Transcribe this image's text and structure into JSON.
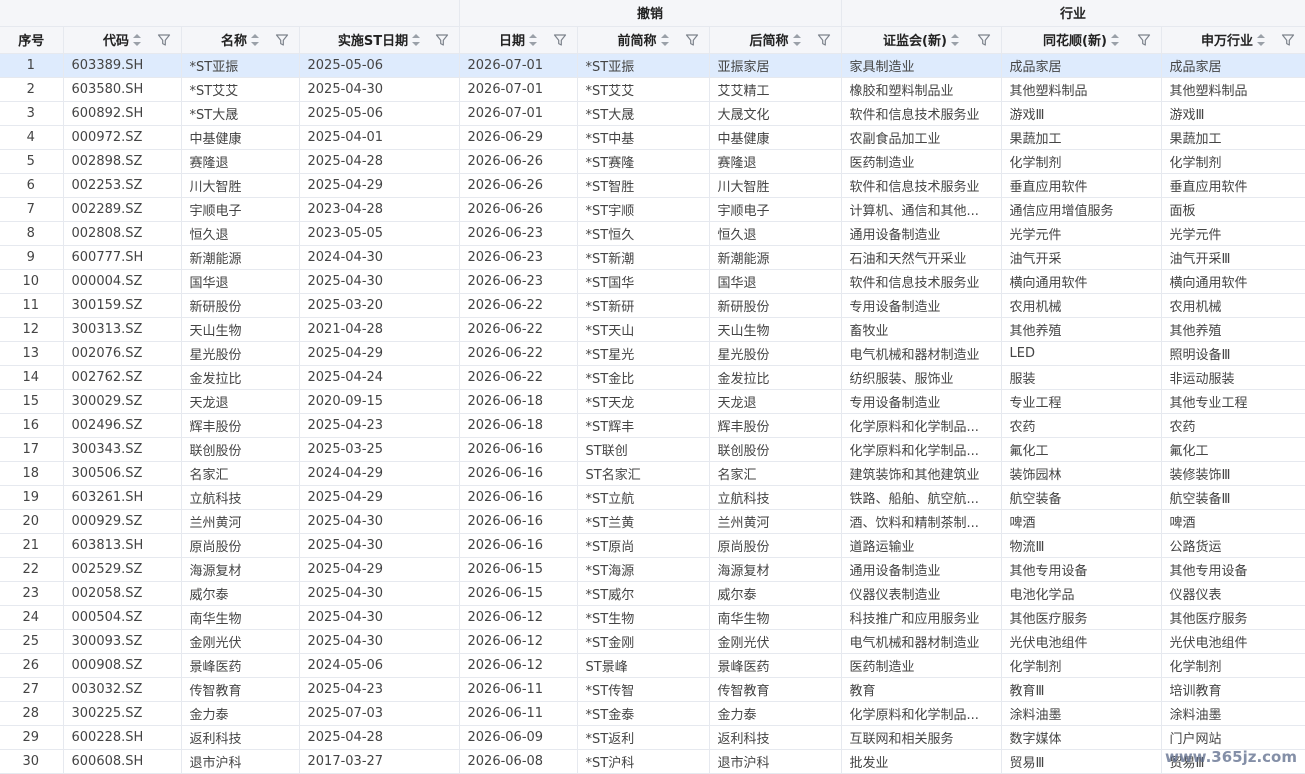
{
  "header": {
    "groups": {
      "revoke": "撤销",
      "industry": "行业"
    },
    "columns": [
      "序号",
      "代码",
      "名称",
      "实施ST日期",
      "日期",
      "前简称",
      "后简称",
      "证监会(新)",
      "同花顺(新)",
      "申万行业"
    ]
  },
  "rows": [
    [
      "1",
      "603389.SH",
      "*ST亚振",
      "2025-05-06",
      "2026-07-01",
      "*ST亚振",
      "亚振家居",
      "家具制造业",
      "成品家居",
      "成品家居"
    ],
    [
      "2",
      "603580.SH",
      "*ST艾艾",
      "2025-04-30",
      "2026-07-01",
      "*ST艾艾",
      "艾艾精工",
      "橡胶和塑料制品业",
      "其他塑料制品",
      "其他塑料制品"
    ],
    [
      "3",
      "600892.SH",
      "*ST大晟",
      "2025-05-06",
      "2026-07-01",
      "*ST大晟",
      "大晟文化",
      "软件和信息技术服务业",
      "游戏Ⅲ",
      "游戏Ⅲ"
    ],
    [
      "4",
      "000972.SZ",
      "中基健康",
      "2025-04-01",
      "2026-06-29",
      "*ST中基",
      "中基健康",
      "农副食品加工业",
      "果蔬加工",
      "果蔬加工"
    ],
    [
      "5",
      "002898.SZ",
      "赛隆退",
      "2025-04-28",
      "2026-06-26",
      "*ST赛隆",
      "赛隆退",
      "医药制造业",
      "化学制剂",
      "化学制剂"
    ],
    [
      "6",
      "002253.SZ",
      "川大智胜",
      "2025-04-29",
      "2026-06-26",
      "*ST智胜",
      "川大智胜",
      "软件和信息技术服务业",
      "垂直应用软件",
      "垂直应用软件"
    ],
    [
      "7",
      "002289.SZ",
      "宇顺电子",
      "2023-04-28",
      "2026-06-26",
      "*ST宇顺",
      "宇顺电子",
      "计算机、通信和其他...",
      "通信应用增值服务",
      "面板"
    ],
    [
      "8",
      "002808.SZ",
      "恒久退",
      "2023-05-05",
      "2026-06-23",
      "*ST恒久",
      "恒久退",
      "通用设备制造业",
      "光学元件",
      "光学元件"
    ],
    [
      "9",
      "600777.SH",
      "新潮能源",
      "2024-04-30",
      "2026-06-23",
      "*ST新潮",
      "新潮能源",
      "石油和天然气开采业",
      "油气开采",
      "油气开采Ⅲ"
    ],
    [
      "10",
      "000004.SZ",
      "国华退",
      "2025-04-30",
      "2026-06-23",
      "*ST国华",
      "国华退",
      "软件和信息技术服务业",
      "横向通用软件",
      "横向通用软件"
    ],
    [
      "11",
      "300159.SZ",
      "新研股份",
      "2025-03-20",
      "2026-06-22",
      "*ST新研",
      "新研股份",
      "专用设备制造业",
      "农用机械",
      "农用机械"
    ],
    [
      "12",
      "300313.SZ",
      "天山生物",
      "2021-04-28",
      "2026-06-22",
      "*ST天山",
      "天山生物",
      "畜牧业",
      "其他养殖",
      "其他养殖"
    ],
    [
      "13",
      "002076.SZ",
      "星光股份",
      "2025-04-29",
      "2026-06-22",
      "*ST星光",
      "星光股份",
      "电气机械和器材制造业",
      "LED",
      "照明设备Ⅲ"
    ],
    [
      "14",
      "002762.SZ",
      "金发拉比",
      "2025-04-24",
      "2026-06-22",
      "*ST金比",
      "金发拉比",
      "纺织服装、服饰业",
      "服装",
      "非运动服装"
    ],
    [
      "15",
      "300029.SZ",
      "天龙退",
      "2020-09-15",
      "2026-06-18",
      "*ST天龙",
      "天龙退",
      "专用设备制造业",
      "专业工程",
      "其他专业工程"
    ],
    [
      "16",
      "002496.SZ",
      "辉丰股份",
      "2025-04-23",
      "2026-06-18",
      "*ST辉丰",
      "辉丰股份",
      "化学原料和化学制品...",
      "农药",
      "农药"
    ],
    [
      "17",
      "300343.SZ",
      "联创股份",
      "2025-03-25",
      "2026-06-16",
      "ST联创",
      "联创股份",
      "化学原料和化学制品...",
      "氟化工",
      "氟化工"
    ],
    [
      "18",
      "300506.SZ",
      "名家汇",
      "2024-04-29",
      "2026-06-16",
      "ST名家汇",
      "名家汇",
      "建筑装饰和其他建筑业",
      "装饰园林",
      "装修装饰Ⅲ"
    ],
    [
      "19",
      "603261.SH",
      "立航科技",
      "2025-04-29",
      "2026-06-16",
      "*ST立航",
      "立航科技",
      "铁路、船舶、航空航...",
      "航空装备",
      "航空装备Ⅲ"
    ],
    [
      "20",
      "000929.SZ",
      "兰州黄河",
      "2025-04-30",
      "2026-06-16",
      "*ST兰黄",
      "兰州黄河",
      "酒、饮料和精制茶制...",
      "啤酒",
      "啤酒"
    ],
    [
      "21",
      "603813.SH",
      "原尚股份",
      "2025-04-30",
      "2026-06-16",
      "*ST原尚",
      "原尚股份",
      "道路运输业",
      "物流Ⅲ",
      "公路货运"
    ],
    [
      "22",
      "002529.SZ",
      "海源复材",
      "2025-04-29",
      "2026-06-15",
      "*ST海源",
      "海源复材",
      "通用设备制造业",
      "其他专用设备",
      "其他专用设备"
    ],
    [
      "23",
      "002058.SZ",
      "威尔泰",
      "2025-04-30",
      "2026-06-15",
      "*ST威尔",
      "威尔泰",
      "仪器仪表制造业",
      "电池化学品",
      "仪器仪表"
    ],
    [
      "24",
      "000504.SZ",
      "南华生物",
      "2025-04-30",
      "2026-06-12",
      "*ST生物",
      "南华生物",
      "科技推广和应用服务业",
      "其他医疗服务",
      "其他医疗服务"
    ],
    [
      "25",
      "300093.SZ",
      "金刚光伏",
      "2025-04-30",
      "2026-06-12",
      "*ST金刚",
      "金刚光伏",
      "电气机械和器材制造业",
      "光伏电池组件",
      "光伏电池组件"
    ],
    [
      "26",
      "000908.SZ",
      "景峰医药",
      "2024-05-06",
      "2026-06-12",
      "ST景峰",
      "景峰医药",
      "医药制造业",
      "化学制剂",
      "化学制剂"
    ],
    [
      "27",
      "003032.SZ",
      "传智教育",
      "2025-04-23",
      "2026-06-11",
      "*ST传智",
      "传智教育",
      "教育",
      "教育Ⅲ",
      "培训教育"
    ],
    [
      "28",
      "300225.SZ",
      "金力泰",
      "2025-07-03",
      "2026-06-11",
      "*ST金泰",
      "金力泰",
      "化学原料和化学制品...",
      "涂料油墨",
      "涂料油墨"
    ],
    [
      "29",
      "600228.SH",
      "返利科技",
      "2025-04-28",
      "2026-06-09",
      "*ST返利",
      "返利科技",
      "互联网和相关服务",
      "数字媒体",
      "门户网站"
    ],
    [
      "30",
      "600608.SH",
      "退市沪科",
      "2017-03-27",
      "2026-06-08",
      "*ST沪科",
      "退市沪科",
      "批发业",
      "贸易Ⅲ",
      "贸易Ⅲ"
    ]
  ],
  "selected_row": 0,
  "watermark": "www.365jz.com"
}
